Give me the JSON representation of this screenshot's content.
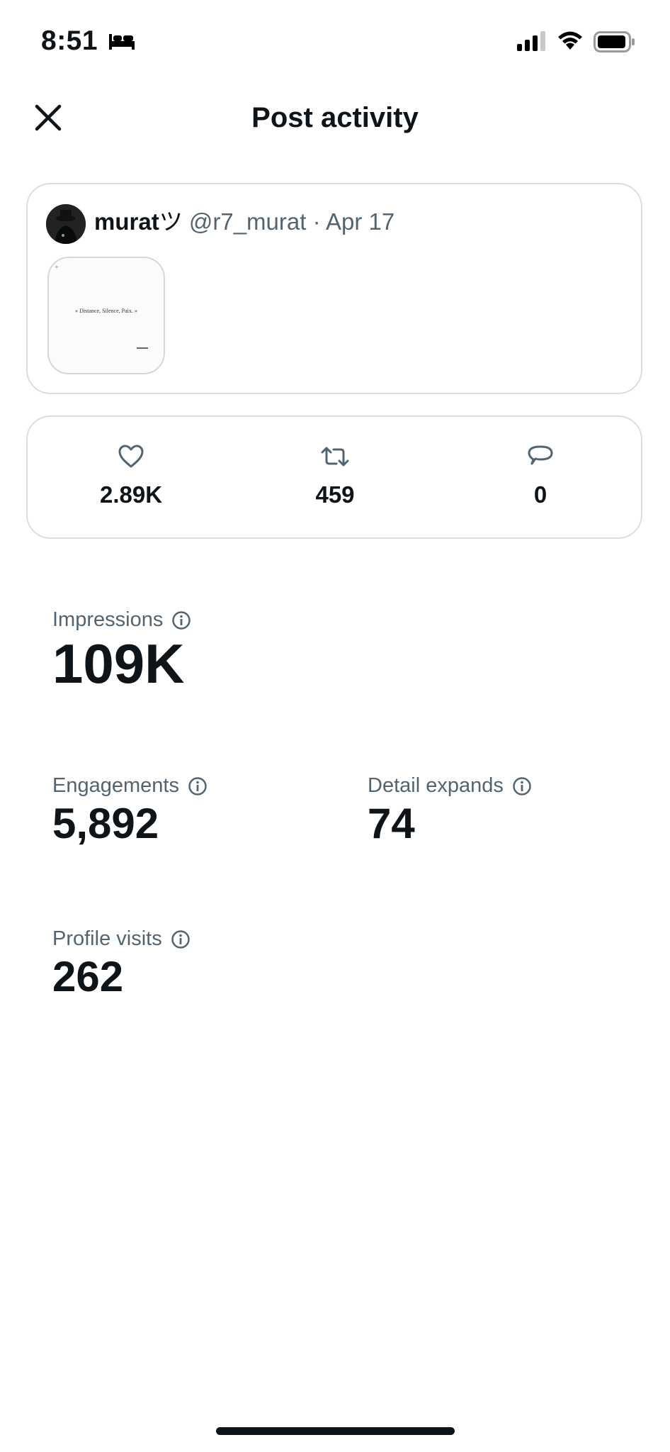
{
  "status_bar": {
    "time": "8:51"
  },
  "header": {
    "title": "Post activity"
  },
  "post": {
    "author_name": "murat",
    "author_badge": "ツ",
    "handle": "@r7_murat",
    "separator": "·",
    "date": "Apr 17",
    "image_text": "« Distance, Silence, Paix. »"
  },
  "engagement": {
    "likes": "2.89K",
    "reposts": "459",
    "replies": "0"
  },
  "metrics": {
    "impressions": {
      "label": "Impressions",
      "value": "109K"
    },
    "engagements": {
      "label": "Engagements",
      "value": "5,892"
    },
    "detail_expands": {
      "label": "Detail expands",
      "value": "74"
    },
    "profile_visits": {
      "label": "Profile visits",
      "value": "262"
    }
  },
  "colors": {
    "text": "#0f1419",
    "secondary": "#536471",
    "border": "#d9dee2"
  }
}
